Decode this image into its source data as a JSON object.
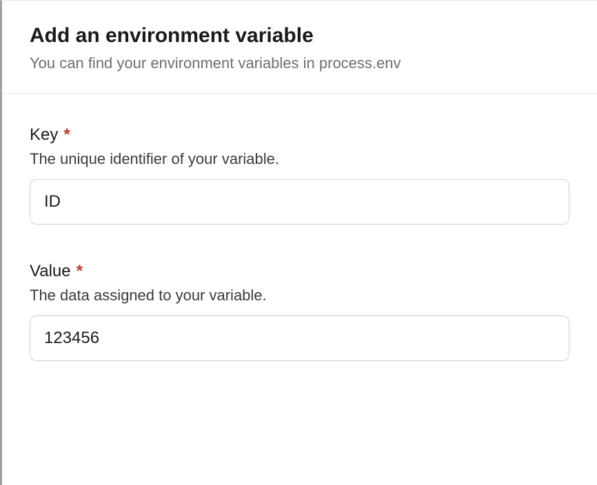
{
  "header": {
    "title": "Add an environment variable",
    "subtitle": "You can find your environment variables in process.env"
  },
  "form": {
    "key": {
      "label": "Key",
      "required_mark": "*",
      "helper": "The unique identifier of your variable.",
      "value": "ID"
    },
    "value": {
      "label": "Value",
      "required_mark": "*",
      "helper": "The data assigned to your variable.",
      "value": "123456"
    }
  }
}
